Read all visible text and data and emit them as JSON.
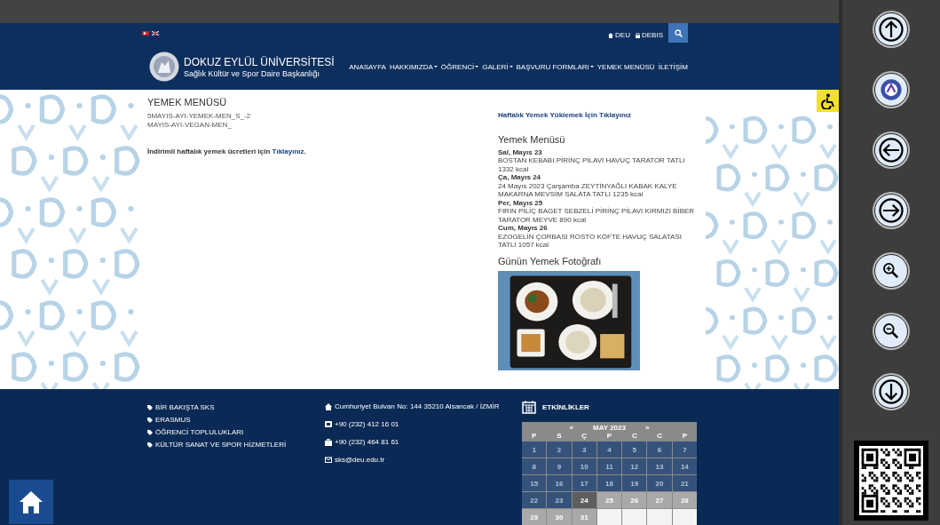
{
  "header": {
    "languages": [
      {
        "kind": "tr"
      },
      {
        "kind": "en"
      }
    ],
    "top_links": [
      {
        "kind": "home",
        "label": "DEU"
      },
      {
        "kind": "lock",
        "label": "DEBIS"
      }
    ],
    "brand": {
      "title": "DOKUZ EYLÜL ÜNİVERSİTESİ",
      "subtitle": "Sağlık Kültür ve Spor Daire Başkanlığı"
    },
    "nav": [
      {
        "label": "ANASAYFA",
        "dropdown": false
      },
      {
        "label": "HAKKIMIZDA",
        "dropdown": true
      },
      {
        "label": "ÖĞRENCİ",
        "dropdown": true
      },
      {
        "label": "GALERİ",
        "dropdown": true
      },
      {
        "label": "BAŞVURU FORMLARI",
        "dropdown": true
      },
      {
        "label": "YEMEK MENÜSÜ",
        "dropdown": false
      },
      {
        "label": "İLETİŞİM",
        "dropdown": false
      }
    ]
  },
  "content": {
    "title": "YEMEK MENÜSÜ",
    "files": [
      "5MAYIS-AYI-YEMEK-MEN_S_-2",
      "MAYIS-AYI-VEGAN-MEN_"
    ],
    "notice_text": "İndirimli haftalık yemek ücretleri için",
    "notice_link": "Tıklayınız.",
    "upload_link": "Haftalık Yemek Yüklemek İçin Tıklayınız",
    "menu": {
      "title": "Yemek Menüsü",
      "days": [
        {
          "date": "Sal, Mayıs 23",
          "items": "BOSTAN KEBABI PİRİNÇ PİLAVI HAVUÇ TARATOR TATLI 1332 kcal"
        },
        {
          "date": "Ça, Mayıs 24",
          "items": "24 Mayıs 2023 Çarşamba ZEYTİNYAĞLI KABAK KALYE MAKARNA MEVSİM SALATA TATLI 1235 kcal"
        },
        {
          "date": "Per, Mayıs 25",
          "items": "FIRIN PİLİÇ BAGET SEBZELİ PİRİNÇ PİLAVI KIRMIZI BİBER TARATOR MEYVE 890 kcal"
        },
        {
          "date": "Cum, Mayıs 26",
          "items": "EZOGELİN ÇORBASI ROSTO KÖFTE HAVUÇ SALATASI TATLI 1057 kcal"
        }
      ]
    },
    "photo": {
      "title": "Günün Yemek Fotoğrafı",
      "kind": "picture"
    }
  },
  "footer": {
    "links": [
      "BİR BAKIŞTA SKS",
      "ERASMUS",
      "ÖĞRENCİ TOPLULUKLARI",
      "KÜLTÜR SANAT VE SPOR HİZMETLERİ"
    ],
    "contacts": [
      {
        "kind": "address",
        "text": "Cumhuriyet Bulvarı No: 144 35210 Alsancak / İZMİR"
      },
      {
        "kind": "phone",
        "text": "+90 (232) 412 16 01"
      },
      {
        "kind": "fax",
        "text": "+90 (232) 464 81 61"
      },
      {
        "kind": "email",
        "text": "sks@deu.edu.tr"
      }
    ],
    "events": {
      "title": "ETKİNLİKLER",
      "calendar": {
        "prev": "«",
        "month": "MAY 2023",
        "next": "»",
        "weekdays": [
          "P",
          "S",
          "Ç",
          "P",
          "C",
          "C",
          "P"
        ],
        "days": [
          {
            "label": "1",
            "kind": "past"
          },
          {
            "label": "2",
            "kind": "past"
          },
          {
            "label": "3",
            "kind": "past"
          },
          {
            "label": "4",
            "kind": "past"
          },
          {
            "label": "5",
            "kind": "past"
          },
          {
            "label": "6",
            "kind": "past"
          },
          {
            "label": "7",
            "kind": "past"
          },
          {
            "label": "8",
            "kind": "past"
          },
          {
            "label": "9",
            "kind": "past"
          },
          {
            "label": "10",
            "kind": "past"
          },
          {
            "label": "11",
            "kind": "past"
          },
          {
            "label": "12",
            "kind": "past"
          },
          {
            "label": "13",
            "kind": "past"
          },
          {
            "label": "14",
            "kind": "past"
          },
          {
            "label": "15",
            "kind": "past"
          },
          {
            "label": "16",
            "kind": "past"
          },
          {
            "label": "17",
            "kind": "past"
          },
          {
            "label": "18",
            "kind": "past"
          },
          {
            "label": "19",
            "kind": "past"
          },
          {
            "label": "20",
            "kind": "past"
          },
          {
            "label": "21",
            "kind": "past"
          },
          {
            "label": "22",
            "kind": "past"
          },
          {
            "label": "23",
            "kind": "past"
          },
          {
            "label": "24",
            "kind": "today"
          },
          {
            "label": "25",
            "kind": "future"
          },
          {
            "label": "26",
            "kind": "future"
          },
          {
            "label": "27",
            "kind": "future"
          },
          {
            "label": "28",
            "kind": "future"
          },
          {
            "label": "29",
            "kind": "future"
          },
          {
            "label": "30",
            "kind": "future"
          },
          {
            "label": "31",
            "kind": "future"
          },
          {
            "kind": "blank"
          },
          {
            "kind": "blank"
          },
          {
            "kind": "blank"
          },
          {
            "kind": "blank"
          }
        ]
      }
    }
  },
  "side_tools": [
    {
      "kind": "up"
    },
    {
      "kind": "logo"
    },
    {
      "kind": "left"
    },
    {
      "kind": "right"
    },
    {
      "kind": "zoom-in"
    },
    {
      "kind": "zoom-out"
    },
    {
      "kind": "down"
    }
  ]
}
